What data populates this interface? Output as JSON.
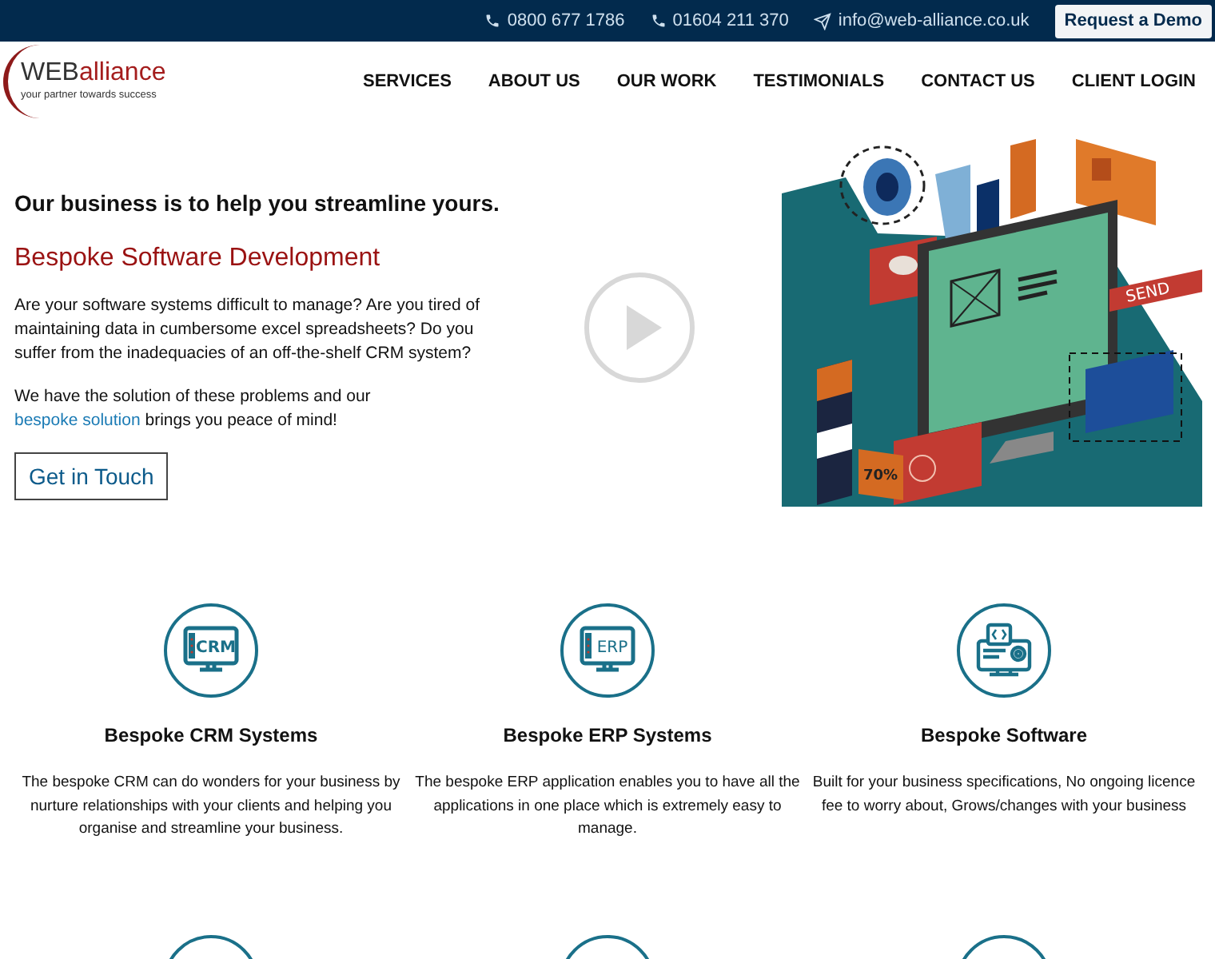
{
  "top_bar": {
    "contacts": [
      {
        "kind": "phone",
        "text": "0800 677 1786"
      },
      {
        "kind": "phone",
        "text": "01604 211 370"
      },
      {
        "kind": "email",
        "text": "info@web-alliance.co.uk"
      }
    ],
    "demo_button": "Request a Demo"
  },
  "logo": {
    "part_1": "WEB",
    "part_2": "alliance",
    "tagline": "your partner towards success"
  },
  "nav": [
    "SERVICES",
    "ABOUT US",
    "OUR WORK",
    "TESTIMONIALS",
    "CONTACT US",
    "CLIENT LOGIN"
  ],
  "hero": {
    "headline": "Our business is to help you streamline yours.",
    "subheading": "Bespoke Software Development",
    "paragraph_1": "Are your software systems difficult to manage? Are you tired of maintaining data in cumbersome excel spreadsheets? Do you suffer from the inadequacies of an off-the-shelf CRM system?",
    "paragraph_2": "We have the solution of these problems and our",
    "link": "bespoke solution",
    "paragraph_2_end": "brings you peace of mind!",
    "button": "Get in Touch",
    "illustration_labels": [
      "SEND",
      "70%"
    ]
  },
  "services": [
    {
      "kind": "crm",
      "icon_text": "CRM",
      "title": "Bespoke CRM Systems",
      "description": "The bespoke CRM can do wonders for your business by nurture relationships with your clients and helping you organise and streamline your business."
    },
    {
      "kind": "erp",
      "icon_text": "ERP",
      "title": "Bespoke ERP Systems",
      "description": "The bespoke ERP application enables you to have all the applications in one place which is extremely easy to manage."
    },
    {
      "kind": "code",
      "title": "Bespoke Software",
      "description": "Built for your business specifications, No ongoing licence fee to worry about, Grows/changes with your business"
    }
  ]
}
